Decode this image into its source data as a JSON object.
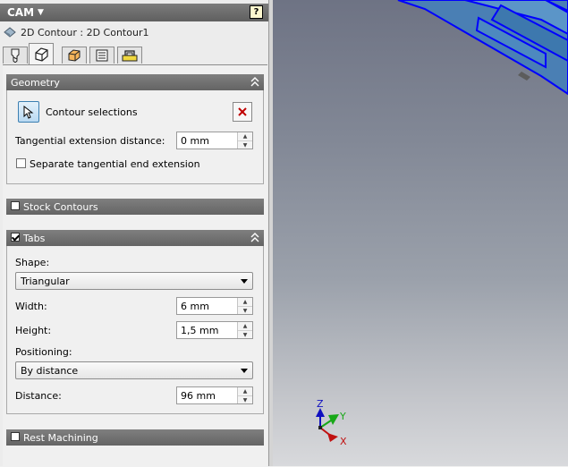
{
  "panel": {
    "title": "CAM",
    "help": "?",
    "breadcrumb": "2D Contour : 2D Contour1",
    "tabs": [
      "tool-icon",
      "geometry-icon",
      "heights-icon",
      "passes-icon",
      "linking-icon"
    ],
    "active_tab": 1
  },
  "geometry": {
    "header": "Geometry",
    "contour_selections": "Contour selections",
    "tangential_label": "Tangential extension distance:",
    "tangential_value": "0 mm",
    "separate_label": "Separate tangential end extension",
    "separate_checked": false
  },
  "stock_contours": {
    "header": "Stock Contours",
    "checked": false
  },
  "tabs_section": {
    "header": "Tabs",
    "checked": true,
    "shape_label": "Shape:",
    "shape_value": "Triangular",
    "width_label": "Width:",
    "width_value": "6 mm",
    "height_label": "Height:",
    "height_value": "1,5 mm",
    "positioning_label": "Positioning:",
    "positioning_value": "By distance",
    "distance_label": "Distance:",
    "distance_value": "96 mm"
  },
  "rest_machining": {
    "header": "Rest Machining",
    "checked": false
  },
  "axes": {
    "z": "Z",
    "y": "Y",
    "x": "X"
  },
  "colors": {
    "header_gray": "#6f6f6f",
    "model_blue": "#0000ff",
    "model_face": "#3d8fc5",
    "axis_z": "#1010c0",
    "axis_y": "#18a818",
    "axis_x": "#c01010"
  }
}
